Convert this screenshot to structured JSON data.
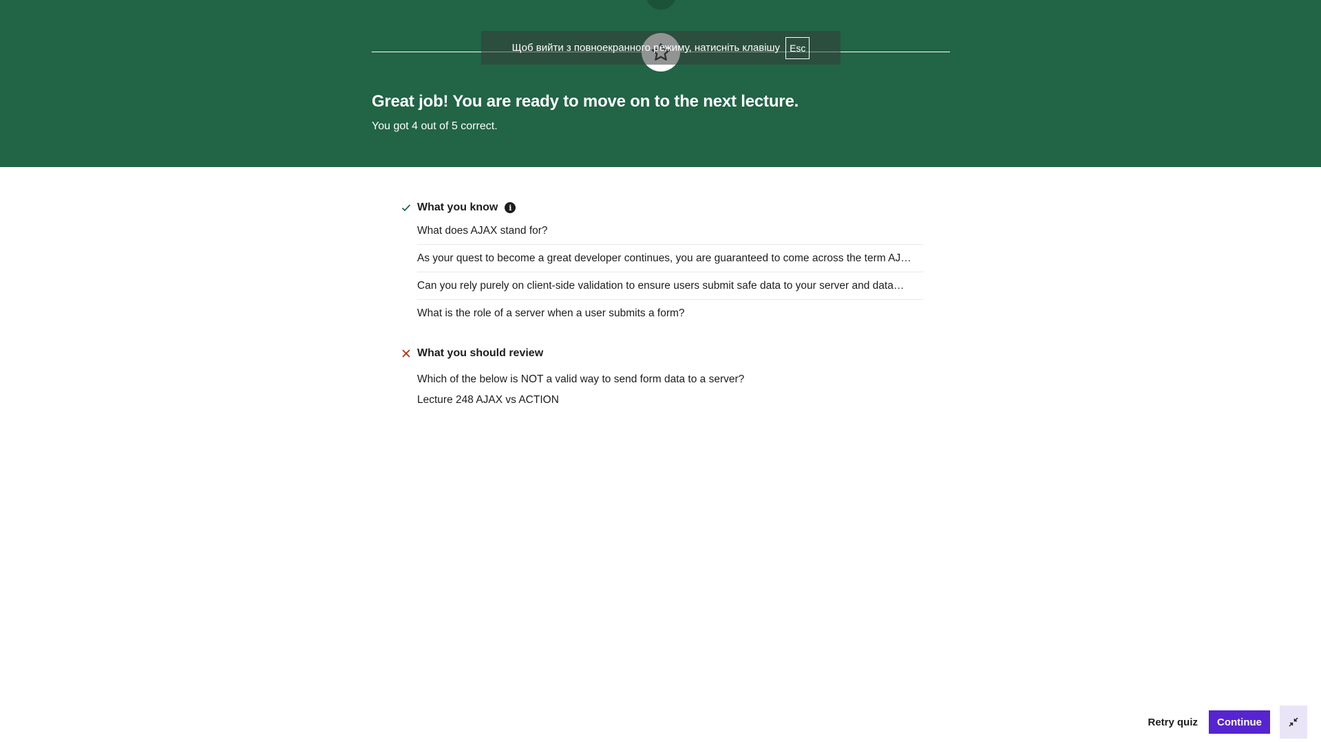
{
  "header": {
    "fullscreen_notice": "Щоб вийти з повноекранного режиму, натисніть клавішу",
    "fullscreen_key": "Esc",
    "title": "Great job! You are ready to move on to the next lecture.",
    "score": "You got 4 out of 5 correct.",
    "background_color": "#216446"
  },
  "known": {
    "title": "What you know",
    "icon": "check-icon",
    "info_icon": "i",
    "questions": [
      "What does AJAX stand for?",
      "As your quest to become a great developer continues, you are guaranteed to come across the term AJ…",
      "Can you rely purely on client-side validation to ensure users submit safe data to your server and data…",
      "What is the role of a server when a user submits a form?"
    ]
  },
  "review": {
    "title": "What you should review",
    "icon": "cross-icon",
    "question": "Which of the below is NOT a valid way to send form data to a server?",
    "lecture": "Lecture 248 AJAX vs ACTION"
  },
  "footer": {
    "retry_label": "Retry quiz",
    "continue_label": "Continue",
    "continue_color": "#5624d0"
  }
}
